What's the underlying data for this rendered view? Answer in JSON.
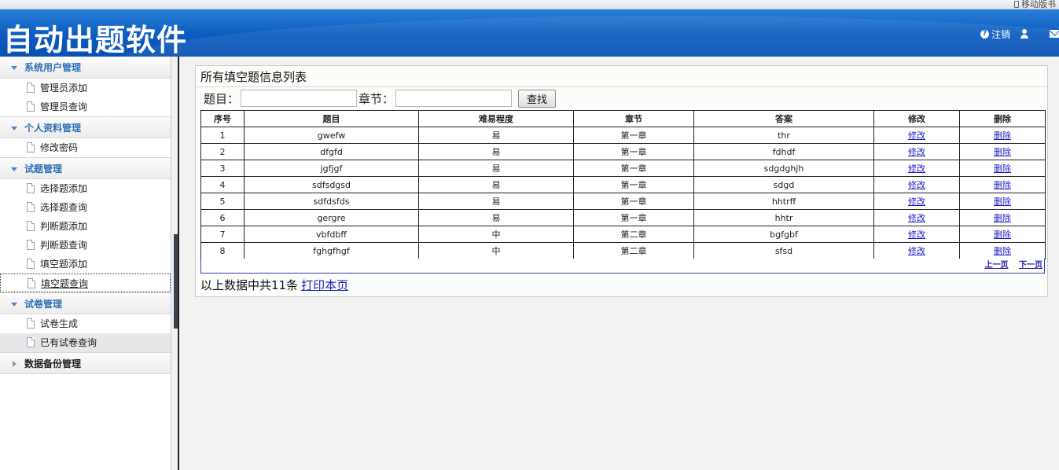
{
  "topbar": {
    "mobile_label": "移动版书"
  },
  "header": {
    "app_title": "自动出题软件",
    "logout_label": "注销"
  },
  "sidebar": {
    "groups": [
      {
        "title": "系统用户管理",
        "items": [
          "管理员添加",
          "管理员查询"
        ]
      },
      {
        "title": "个人资料管理",
        "items": [
          "修改密码"
        ]
      },
      {
        "title": "试题管理",
        "items": [
          "选择题添加",
          "选择题查询",
          "判断题添加",
          "判断题查询",
          "填空题添加",
          "填空题查询"
        ]
      },
      {
        "title": "试卷管理",
        "items": [
          "试卷生成",
          "已有试卷查询"
        ]
      },
      {
        "title": "数据备份管理",
        "items": []
      }
    ],
    "active_item": "填空题查询"
  },
  "main": {
    "panel_title": "所有填空题信息列表",
    "search": {
      "topic_label": "题目：",
      "topic_value": "",
      "chapter_label": "章节：",
      "chapter_value": "",
      "search_button": "查找"
    },
    "table": {
      "columns": [
        "序号",
        "题目",
        "难易程度",
        "章节",
        "答案",
        "修改",
        "删除"
      ],
      "rows": [
        [
          "1",
          "gwefw",
          "易",
          "第一章",
          "thr",
          "修改",
          "删除"
        ],
        [
          "2",
          "dfgfd",
          "易",
          "第一章",
          "fdhdf",
          "修改",
          "删除"
        ],
        [
          "3",
          "jgfjgf",
          "易",
          "第一章",
          "sdgdghjh",
          "修改",
          "删除"
        ],
        [
          "4",
          "sdfsdgsd",
          "易",
          "第一章",
          "sdgd",
          "修改",
          "删除"
        ],
        [
          "5",
          "sdfdsfds",
          "易",
          "第一章",
          "hhtrff",
          "修改",
          "删除"
        ],
        [
          "6",
          "gergre",
          "易",
          "第一章",
          "hhtr",
          "修改",
          "删除"
        ],
        [
          "7",
          "vbfdbff",
          "中",
          "第二章",
          "bgfgbf",
          "修改",
          "删除"
        ],
        [
          "8",
          "fghgfhgf",
          "中",
          "第二章",
          "sfsd",
          "修改",
          "删除"
        ]
      ]
    },
    "pager": {
      "prev": "上一页",
      "next": "下一页"
    },
    "footer": {
      "summary": "以上数据中共11条",
      "print_link": "打印本页"
    }
  },
  "colors": {
    "header_blue": "#0b5bbf",
    "sidebar_accent": "#2f72b6",
    "link": "#2020c8"
  }
}
